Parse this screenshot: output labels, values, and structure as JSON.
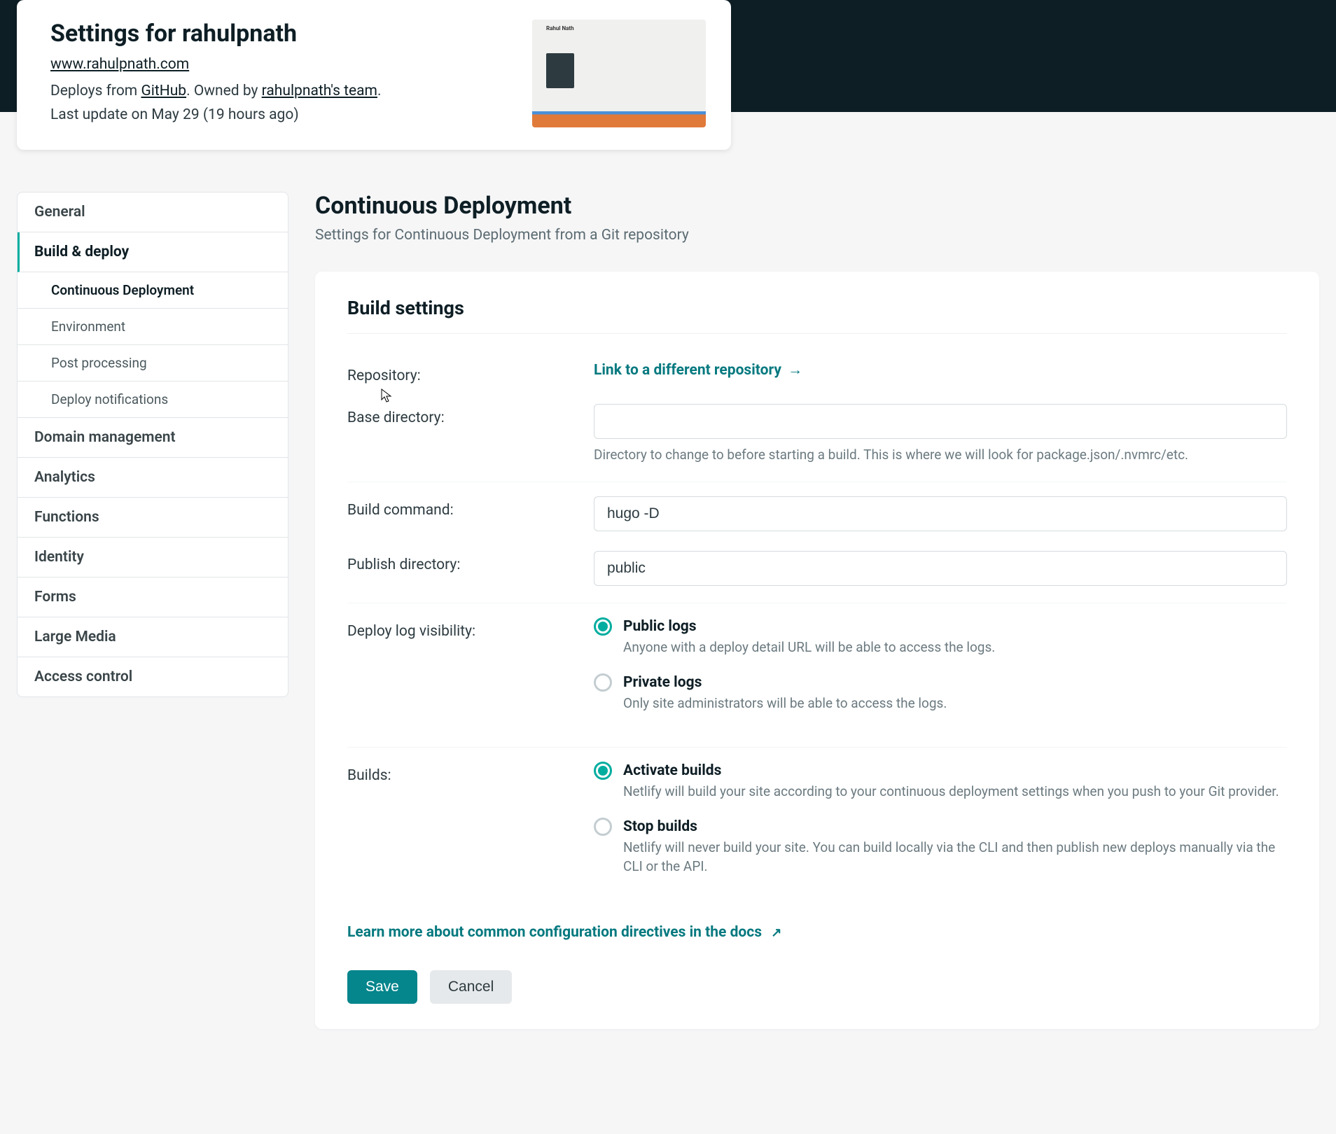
{
  "site_header": {
    "title": "Settings for rahulpnath",
    "url": "www.rahulpnath.com",
    "deploys_from_prefix": "Deploys from ",
    "deploys_from_source": "GitHub",
    "owned_by_prefix": ". Owned by ",
    "owned_by_team": "rahulpnath's team",
    "owned_by_suffix": ".",
    "last_update": "Last update on May 29 (19 hours ago)",
    "preview_name": "Rahul Nath"
  },
  "sidebar": {
    "items": [
      {
        "label": "General",
        "active": false
      },
      {
        "label": "Build & deploy",
        "active": true
      },
      {
        "label": "Domain management",
        "active": false
      },
      {
        "label": "Analytics",
        "active": false
      },
      {
        "label": "Functions",
        "active": false
      },
      {
        "label": "Identity",
        "active": false
      },
      {
        "label": "Forms",
        "active": false
      },
      {
        "label": "Large Media",
        "active": false
      },
      {
        "label": "Access control",
        "active": false
      }
    ],
    "subitems": [
      {
        "label": "Continuous Deployment",
        "active": true
      },
      {
        "label": "Environment",
        "active": false
      },
      {
        "label": "Post processing",
        "active": false
      },
      {
        "label": "Deploy notifications",
        "active": false
      }
    ]
  },
  "content": {
    "heading": "Continuous Deployment",
    "subheading": "Settings for Continuous Deployment from a Git repository",
    "panel_title": "Build settings",
    "repository": {
      "label": "Repository:",
      "link_text": "Link to a different repository",
      "link_arrow": "→"
    },
    "base_directory": {
      "label": "Base directory:",
      "value": "",
      "help": "Directory to change to before starting a build. This is where we will look for package.json/.nvmrc/etc."
    },
    "build_command": {
      "label": "Build command:",
      "value": "hugo -D"
    },
    "publish_directory": {
      "label": "Publish directory:",
      "value": "public"
    },
    "deploy_log": {
      "label": "Deploy log visibility:",
      "options": [
        {
          "title": "Public logs",
          "desc": "Anyone with a deploy detail URL will be able to access the logs.",
          "selected": true
        },
        {
          "title": "Private logs",
          "desc": "Only site administrators will be able to access the logs.",
          "selected": false
        }
      ]
    },
    "builds": {
      "label": "Builds:",
      "options": [
        {
          "title": "Activate builds",
          "desc": "Netlify will build your site according to your continuous deployment settings when you push to your Git provider.",
          "selected": true
        },
        {
          "title": "Stop builds",
          "desc": "Netlify will never build your site. You can build locally via the CLI and then publish new deploys manually via the CLI or the API.",
          "selected": false
        }
      ]
    },
    "learn_more": "Learn more about common configuration directives in the docs",
    "learn_more_icon": "↗",
    "save_btn": "Save",
    "cancel_btn": "Cancel"
  },
  "colors": {
    "accent": "#00ad9f",
    "link": "#05797f"
  }
}
